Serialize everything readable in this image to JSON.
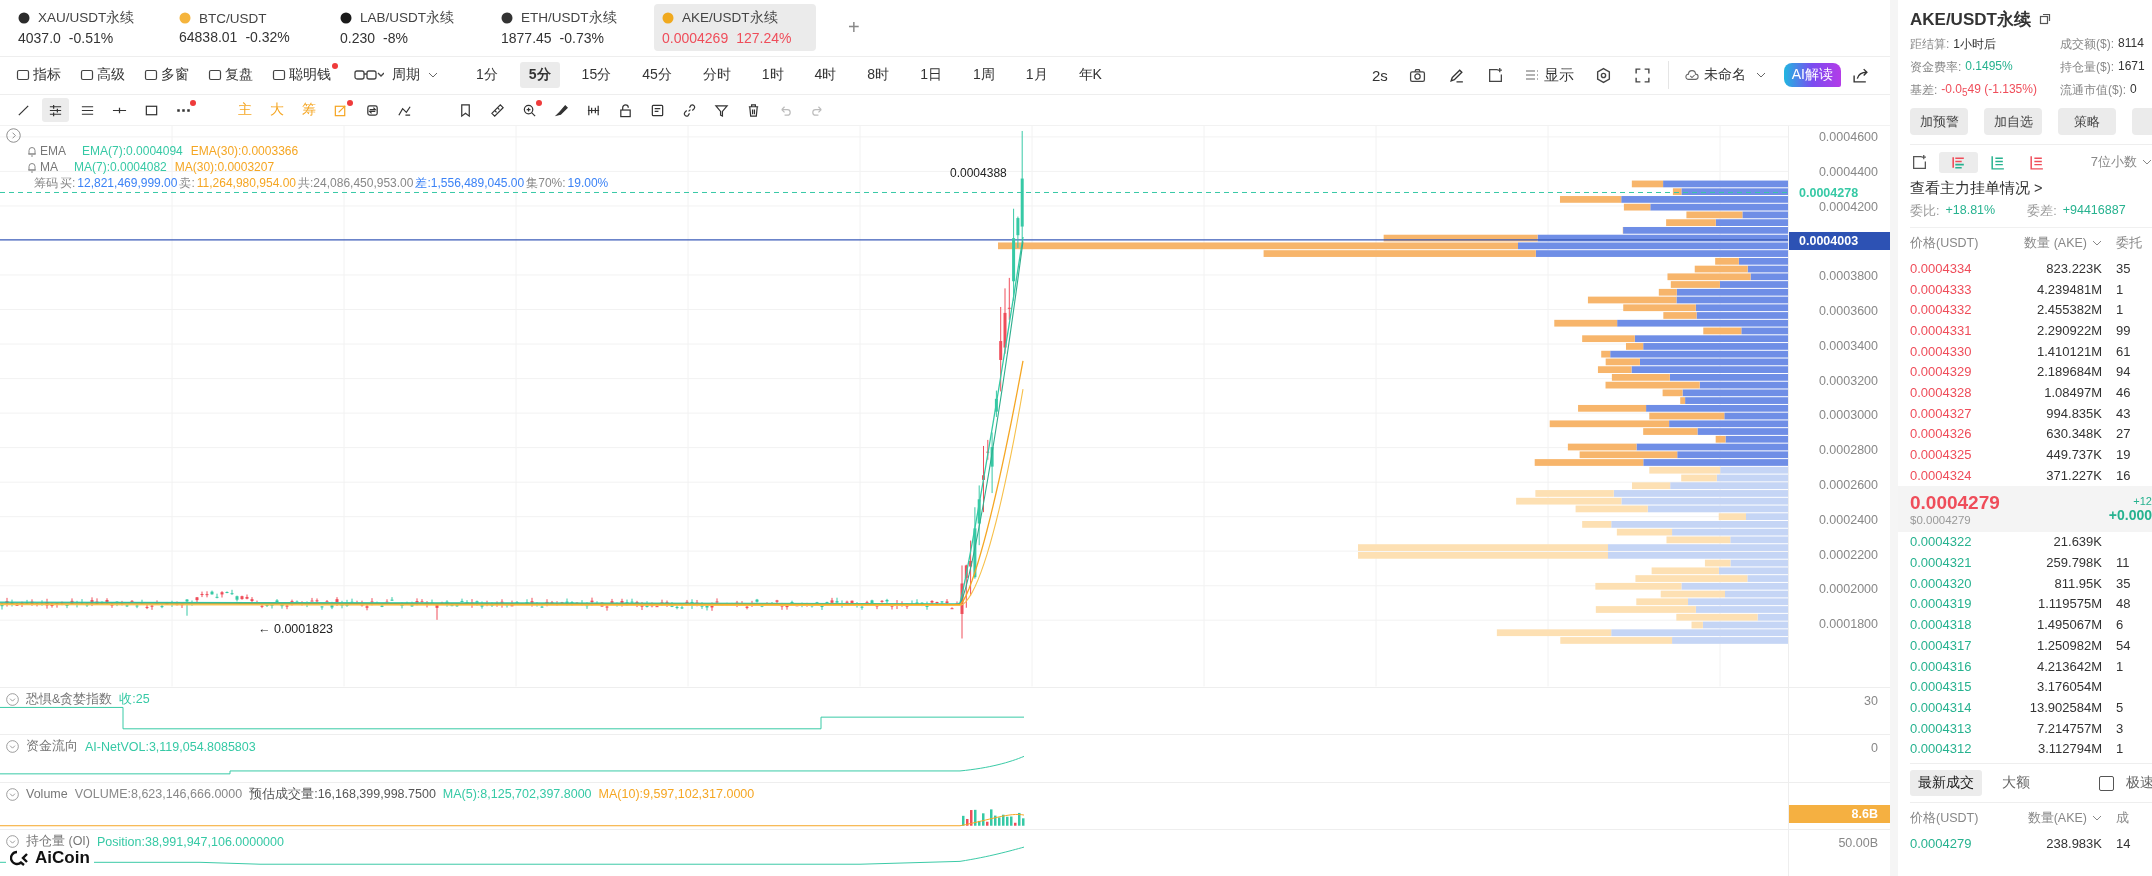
{
  "tickers": [
    {
      "symbol": "XAU/USDT永续",
      "price": "4037.0",
      "change": "-0.51%",
      "color": "#2b2b2b",
      "selected": false
    },
    {
      "symbol": "BTC/USDT",
      "price": "64838.01",
      "change": "-0.32%",
      "color": "#f5b43c",
      "selected": false
    },
    {
      "symbol": "LAB/USDT永续",
      "price": "0.230",
      "change": "-8%",
      "color": "#1a1a1a",
      "selected": false
    },
    {
      "symbol": "ETH/USDT永续",
      "price": "1877.45",
      "change": "-0.73%",
      "color": "#333333",
      "selected": false
    },
    {
      "symbol": "AKE/USDT永续",
      "price": "0.0004269",
      "change": "127.24%",
      "color": "#f0a91e",
      "selected": true
    }
  ],
  "add_tab": "+",
  "toolbar": {
    "menus": [
      {
        "label": "指标",
        "dot": false
      },
      {
        "label": "高级",
        "dot": false
      },
      {
        "label": "多窗",
        "dot": false
      },
      {
        "label": "复盘",
        "dot": false
      },
      {
        "label": "聪明钱",
        "dot": true
      }
    ],
    "period_menu": "周期",
    "periods": [
      {
        "label": "1分",
        "selected": false
      },
      {
        "label": "5分",
        "selected": true
      },
      {
        "label": "15分",
        "selected": false
      },
      {
        "label": "45分",
        "selected": false
      },
      {
        "label": "分时",
        "selected": false
      },
      {
        "label": "1时",
        "selected": false
      },
      {
        "label": "4时",
        "selected": false
      },
      {
        "label": "8时",
        "selected": false
      },
      {
        "label": "1日",
        "selected": false
      },
      {
        "label": "1周",
        "selected": false
      },
      {
        "label": "1月",
        "selected": false
      },
      {
        "label": "年K",
        "selected": false
      }
    ],
    "refresh": "2s",
    "display": "显示",
    "layout_name": "未命名",
    "ai_button": "AI解读"
  },
  "drawing_tools": [
    {
      "kind": "icon",
      "selected": false,
      "dot": false
    },
    {
      "kind": "icon",
      "selected": true,
      "dot": false
    },
    {
      "kind": "icon",
      "selected": false,
      "dot": false
    },
    {
      "kind": "icon",
      "selected": false,
      "dot": false
    },
    {
      "kind": "icon",
      "selected": false,
      "dot": false
    },
    {
      "kind": "icon",
      "selected": false,
      "dot": true
    },
    {
      "kind": "glyph",
      "label": "主",
      "selected": false,
      "dot": false
    },
    {
      "kind": "glyph",
      "label": "大",
      "selected": false,
      "dot": false
    },
    {
      "kind": "glyph",
      "label": "筹",
      "selected": false,
      "dot": false
    },
    {
      "kind": "icon",
      "selected": false,
      "dot": true
    },
    {
      "kind": "icon",
      "selected": false,
      "dot": false
    },
    {
      "kind": "icon",
      "selected": false,
      "dot": false
    },
    {
      "kind": "icon",
      "selected": false,
      "dot": false
    },
    {
      "kind": "icon",
      "selected": false,
      "dot": false
    },
    {
      "kind": "icon",
      "selected": false,
      "dot": true
    },
    {
      "kind": "icon",
      "selected": false,
      "dot": false
    },
    {
      "kind": "icon",
      "selected": false,
      "dot": false
    },
    {
      "kind": "icon",
      "selected": false,
      "dot": false
    },
    {
      "kind": "icon",
      "selected": false,
      "dot": false
    },
    {
      "kind": "icon",
      "selected": false,
      "dot": false
    },
    {
      "kind": "icon",
      "selected": false,
      "dot": false
    },
    {
      "kind": "icon",
      "selected": false,
      "dot": false
    },
    {
      "kind": "icon",
      "selected": false,
      "dot": false
    },
    {
      "kind": "icon",
      "selected": false,
      "dot": false
    }
  ],
  "chart": {
    "legends": [
      {
        "name": "EMA",
        "values": [
          {
            "text": "EMA(7):0.0004094",
            "color": "#36c9a5"
          },
          {
            "text": "EMA(30):0.0003366",
            "color": "#f5a623"
          }
        ]
      },
      {
        "name": "MA",
        "values": [
          {
            "text": "MA(7):0.0004082",
            "color": "#36c9a5"
          },
          {
            "text": "MA(30):0.0003207",
            "color": "#f5a623"
          }
        ]
      }
    ],
    "chips": [
      {
        "text": "筹码",
        "color": "#888888"
      },
      {
        "text": "买:",
        "color": "#888888"
      },
      {
        "text": "12,821,469,999.00",
        "color": "#3b82f6"
      },
      {
        "text": "卖:",
        "color": "#888888"
      },
      {
        "text": "11,264,980,954.00",
        "color": "#f5a623"
      },
      {
        "text": "共:24,086,450,953.00",
        "color": "#888888"
      },
      {
        "text": "差:1,556,489,045.00",
        "color": "#3b82f6"
      },
      {
        "text": "集70%:",
        "color": "#888888"
      },
      {
        "text": "19.00%",
        "color": "#3b82f6"
      }
    ],
    "high_label": "0.0004388",
    "low_label": "← 0.0001823",
    "price_axis": [
      "0.0004600",
      "0.0004400",
      "0.0004200",
      "0.0003800",
      "0.0003600",
      "0.0003400",
      "0.0003200",
      "0.0003000",
      "0.0002800",
      "0.0002600",
      "0.0002400",
      "0.0002200",
      "0.0002000",
      "0.0001800"
    ],
    "last_price_tag": "0.0004278",
    "crosshair_tag": "0.0004003"
  },
  "panes": [
    {
      "kind": "fear",
      "title": "恐惧&贪婪指数",
      "values": [
        {
          "text": "收:25",
          "color": "#36c9a5"
        }
      ],
      "axis_label": "30"
    },
    {
      "kind": "flow",
      "title": "资金流向",
      "values": [
        {
          "text": "AI-NetVOL:3,119,054.8085803",
          "color": "#36c9a5"
        }
      ],
      "axis_label": "0"
    },
    {
      "kind": "volume",
      "title": "Volume",
      "values": [
        {
          "text": "VOLUME:8,623,146,666.0000",
          "color": "#888888"
        },
        {
          "text": "预估成交量:16,168,399,998.7500",
          "color": "#555555"
        },
        {
          "text": "MA(5):8,125,702,397.8000",
          "color": "#36c9a5"
        },
        {
          "text": "MA(10):9,597,102,317.0000",
          "color": "#f5a623"
        }
      ],
      "axis_tag": "8.6B"
    },
    {
      "kind": "oi",
      "title": "持仓量 (OI)",
      "values": [
        {
          "text": "Position:38,991,947,106.0000000",
          "color": "#36c9a5"
        }
      ],
      "axis_label": "50.00B"
    }
  ],
  "logo": "AiCoin",
  "side": {
    "title": "AKE/USDT永续",
    "stats": [
      {
        "label": "距结算:",
        "value": "1小时后",
        "color": "#333333"
      },
      {
        "label": "成交额($):",
        "value": "8114",
        "color": "#333333"
      },
      {
        "label": "资金费率:",
        "value": "0.1495%",
        "color": "#26b28f"
      },
      {
        "label": "持仓量($):",
        "value": "1671",
        "color": "#333333"
      },
      {
        "label": "基差:",
        "value": "-0.0$_{5}$49 (-1.135%)",
        "color": "#ef4d5a"
      },
      {
        "label": "流通市值($):",
        "value": "0",
        "color": "#333333"
      }
    ],
    "buttons": [
      "加预警",
      "加自选",
      "策略"
    ],
    "decimals": "7位小数",
    "view_link": "查看主力挂单情况 >",
    "ratio_label": "委比:",
    "ratio": "+18.81%",
    "diff_label": "委差:",
    "diff": "+94416887",
    "book_columns": [
      "价格(USDT)",
      "数量 (AKE)",
      "委托"
    ],
    "asks": [
      {
        "price": "0.0004334",
        "qty": "823.223K",
        "total": "35"
      },
      {
        "price": "0.0004333",
        "qty": "4.239481M",
        "total": "1"
      },
      {
        "price": "0.0004332",
        "qty": "2.455382M",
        "total": "1"
      },
      {
        "price": "0.0004331",
        "qty": "2.290922M",
        "total": "99"
      },
      {
        "price": "0.0004330",
        "qty": "1.410121M",
        "total": "61"
      },
      {
        "price": "0.0004329",
        "qty": "2.189684M",
        "total": "94"
      },
      {
        "price": "0.0004328",
        "qty": "1.08497M",
        "total": "46"
      },
      {
        "price": "0.0004327",
        "qty": "994.835K",
        "total": "43"
      },
      {
        "price": "0.0004326",
        "qty": "630.348K",
        "total": "27"
      },
      {
        "price": "0.0004325",
        "qty": "449.737K",
        "total": "19"
      },
      {
        "price": "0.0004324",
        "qty": "371.227K",
        "total": "16"
      }
    ],
    "last": {
      "price": "0.0004279",
      "usd": "$0.0004279",
      "change_pct": "+12",
      "change": "+0.000"
    },
    "bids": [
      {
        "price": "0.0004322",
        "qty": "21.639K"
      },
      {
        "price": "0.0004321",
        "qty": "259.798K",
        "total": "11"
      },
      {
        "price": "0.0004320",
        "qty": "811.95K",
        "total": "35"
      },
      {
        "price": "0.0004319",
        "qty": "1.119575M",
        "total": "48"
      },
      {
        "price": "0.0004318",
        "qty": "1.495067M",
        "total": "6"
      },
      {
        "price": "0.0004317",
        "qty": "1.250982M",
        "total": "54"
      },
      {
        "price": "0.0004316",
        "qty": "4.213642M",
        "total": "1"
      },
      {
        "price": "0.0004315",
        "qty": "3.176054M"
      },
      {
        "price": "0.0004314",
        "qty": "13.902584M",
        "total": "5"
      },
      {
        "price": "0.0004313",
        "qty": "7.214757M",
        "total": "3"
      },
      {
        "price": "0.0004312",
        "qty": "3.112794M",
        "total": "1"
      }
    ],
    "trade_tabs": [
      {
        "label": "最新成交",
        "selected": true
      },
      {
        "label": "大额",
        "selected": false
      }
    ],
    "fast": {
      "label": "极速",
      "checked": false
    },
    "trade_columns": [
      "价格(USDT)",
      "数量(AKE)",
      "成"
    ],
    "trades": [
      {
        "price": "0.0004279",
        "qty": "238.983K",
        "total": "14"
      }
    ]
  }
}
